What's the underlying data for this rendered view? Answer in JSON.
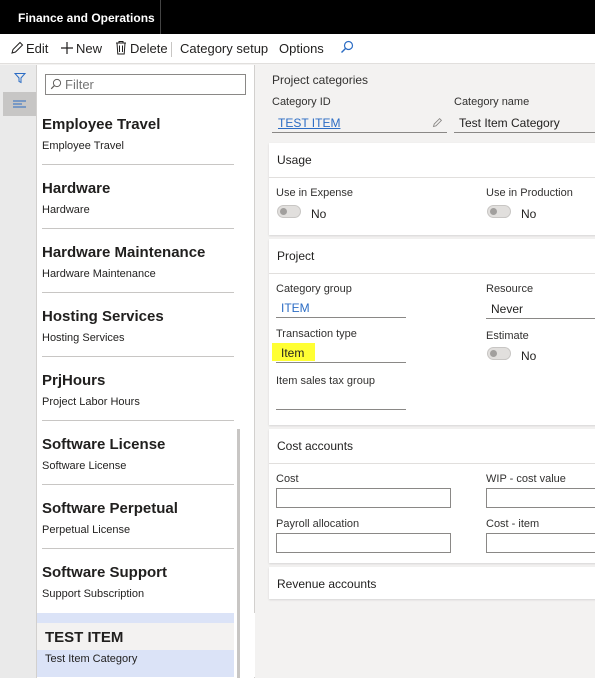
{
  "app": {
    "title": "Finance and Operations"
  },
  "toolbar": {
    "edit_label": "Edit",
    "new_label": "New",
    "delete_label": "Delete",
    "category_setup_label": "Category setup",
    "options_label": "Options"
  },
  "list": {
    "filter_placeholder": "Filter",
    "items": [
      {
        "title": "Employee Travel",
        "subtitle": "Employee Travel"
      },
      {
        "title": "Hardware",
        "subtitle": "Hardware"
      },
      {
        "title": "Hardware Maintenance",
        "subtitle": "Hardware Maintenance"
      },
      {
        "title": "Hosting Services",
        "subtitle": "Hosting Services"
      },
      {
        "title": "PrjHours",
        "subtitle": "Project Labor Hours"
      },
      {
        "title": "Software License",
        "subtitle": "Software License"
      },
      {
        "title": "Software Perpetual",
        "subtitle": "Perpetual License"
      },
      {
        "title": "Software Support",
        "subtitle": "Support Subscription"
      },
      {
        "title": "TEST ITEM",
        "subtitle": "Test Item Category",
        "selected": true
      }
    ]
  },
  "detail": {
    "caption": "Project categories",
    "category_id_label": "Category ID",
    "category_id_value": "TEST ITEM",
    "category_name_label": "Category name",
    "category_name_value": "Test Item Category",
    "usage": {
      "title": "Usage",
      "use_in_expense_label": "Use in Expense",
      "use_in_expense_value": "No",
      "use_in_production_label": "Use in Production",
      "use_in_production_value": "No"
    },
    "project": {
      "title": "Project",
      "category_group_label": "Category group",
      "category_group_value": "ITEM",
      "resource_label": "Resource",
      "resource_value": "Never",
      "transaction_type_label": "Transaction type",
      "transaction_type_value": "Item",
      "estimate_label": "Estimate",
      "estimate_value": "No",
      "item_sales_tax_group_label": "Item sales tax group",
      "item_sales_tax_group_value": ""
    },
    "cost_accounts": {
      "title": "Cost accounts",
      "cost_label": "Cost",
      "wip_cost_value_label": "WIP - cost value",
      "payroll_allocation_label": "Payroll allocation",
      "cost_item_label": "Cost - item"
    },
    "revenue_accounts": {
      "title": "Revenue accounts"
    }
  },
  "colors": {
    "highlight": "#ffff33",
    "link": "#2b6cc4",
    "selection": "#dbe3f7",
    "appbar": "#000000"
  }
}
